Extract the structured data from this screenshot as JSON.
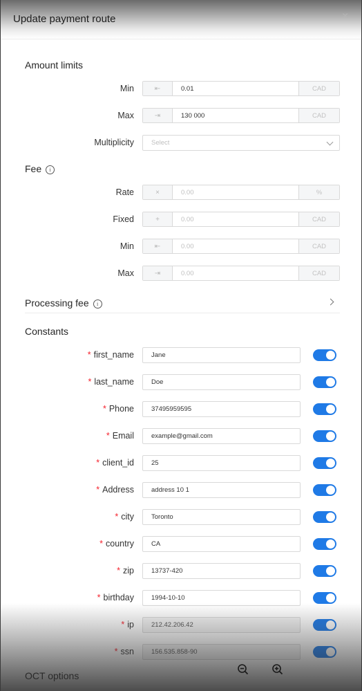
{
  "modal": {
    "title": "Update payment route",
    "close_glyph": "×"
  },
  "amount_limits": {
    "title": "Amount limits",
    "rows": [
      {
        "label": "Min",
        "value": "0.01",
        "prefix_icon": "arrow-to-left-icon",
        "suffix": "CAD"
      },
      {
        "label": "Max",
        "value": "130 000",
        "prefix_icon": "arrow-to-right-icon",
        "suffix": "CAD"
      }
    ],
    "multiplicity": {
      "label": "Multiplicity",
      "placeholder": "Select"
    }
  },
  "fee": {
    "title": "Fee",
    "rows": [
      {
        "label": "Rate",
        "placeholder": "0.00",
        "prefix": "×",
        "suffix": "%"
      },
      {
        "label": "Fixed",
        "placeholder": "0.00",
        "prefix": "+",
        "suffix": "CAD"
      },
      {
        "label": "Min",
        "placeholder": "0.00",
        "prefix": "⇤",
        "suffix": "CAD"
      },
      {
        "label": "Max",
        "placeholder": "0.00",
        "prefix": "⇥",
        "suffix": "CAD"
      }
    ]
  },
  "processing_fee": {
    "title": "Processing fee"
  },
  "constants": {
    "title": "Constants",
    "required_mark": "*",
    "items": [
      {
        "label": "first_name",
        "value": "Jane",
        "enabled": true
      },
      {
        "label": "last_name",
        "value": "Doe",
        "enabled": true
      },
      {
        "label": "Phone",
        "value": "37495959595",
        "enabled": true
      },
      {
        "label": "Email",
        "value": "example@gmail.com",
        "enabled": true
      },
      {
        "label": "client_id",
        "value": "25",
        "enabled": true
      },
      {
        "label": "Address",
        "value": "address 10 1",
        "enabled": true
      },
      {
        "label": "city",
        "value": "Toronto",
        "enabled": true
      },
      {
        "label": "country",
        "value": "CA",
        "enabled": true
      },
      {
        "label": "zip",
        "value": "13737-420",
        "enabled": true
      },
      {
        "label": "birthday",
        "value": "1994-10-10",
        "enabled": true
      },
      {
        "label": "ip",
        "value": "212.42.206.42",
        "enabled": true
      },
      {
        "label": "ssn",
        "value": "156.535.858-90",
        "enabled": true
      }
    ]
  },
  "oct_options": {
    "title": "OCT options"
  },
  "colors": {
    "accent": "#1f7ae6",
    "required": "#f5222d"
  }
}
